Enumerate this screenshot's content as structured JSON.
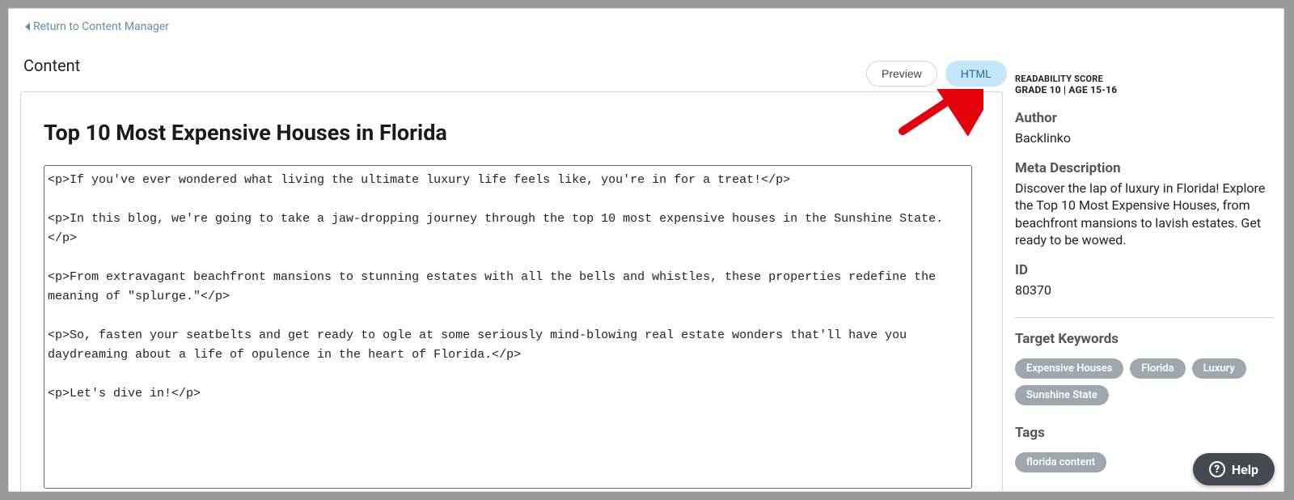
{
  "nav": {
    "return_label": "Return to Content Manager"
  },
  "header": {
    "content_label": "Content",
    "toggle": {
      "preview": "Preview",
      "html": "HTML"
    }
  },
  "editor": {
    "title": "Top 10 Most Expensive Houses in Florida",
    "html_source": "<p>If you've ever wondered what living the ultimate luxury life feels like, you're in for a treat!</p>\n\n<p>In this blog, we're going to take a jaw-dropping journey through the top 10 most expensive houses in the Sunshine State.</p>\n\n<p>From extravagant beachfront mansions to stunning estates with all the bells and whistles, these properties redefine the meaning of \"splurge.\"</p>\n\n<p>So, fasten your seatbelts and get ready to ogle at some seriously mind-blowing real estate wonders that'll have you daydreaming about a life of opulence in the heart of Florida.</p>\n\n<p>Let's dive in!</p>"
  },
  "sidebar": {
    "readability_label": "READABILITY SCORE",
    "readability_value": "GRADE 10 | AGE 15-16",
    "author_label": "Author",
    "author_value": "Backlinko",
    "meta_label": "Meta Description",
    "meta_value": "Discover the lap of luxury in Florida! Explore the Top 10 Most Expensive Houses, from beachfront mansions to lavish estates. Get ready to be wowed.",
    "id_label": "ID",
    "id_value": "80370",
    "keywords_label": "Target Keywords",
    "keywords": [
      "Expensive Houses",
      "Florida",
      "Luxury",
      "Sunshine State"
    ],
    "tags_label": "Tags",
    "tags": [
      "florida content"
    ]
  },
  "help": {
    "label": "Help"
  }
}
